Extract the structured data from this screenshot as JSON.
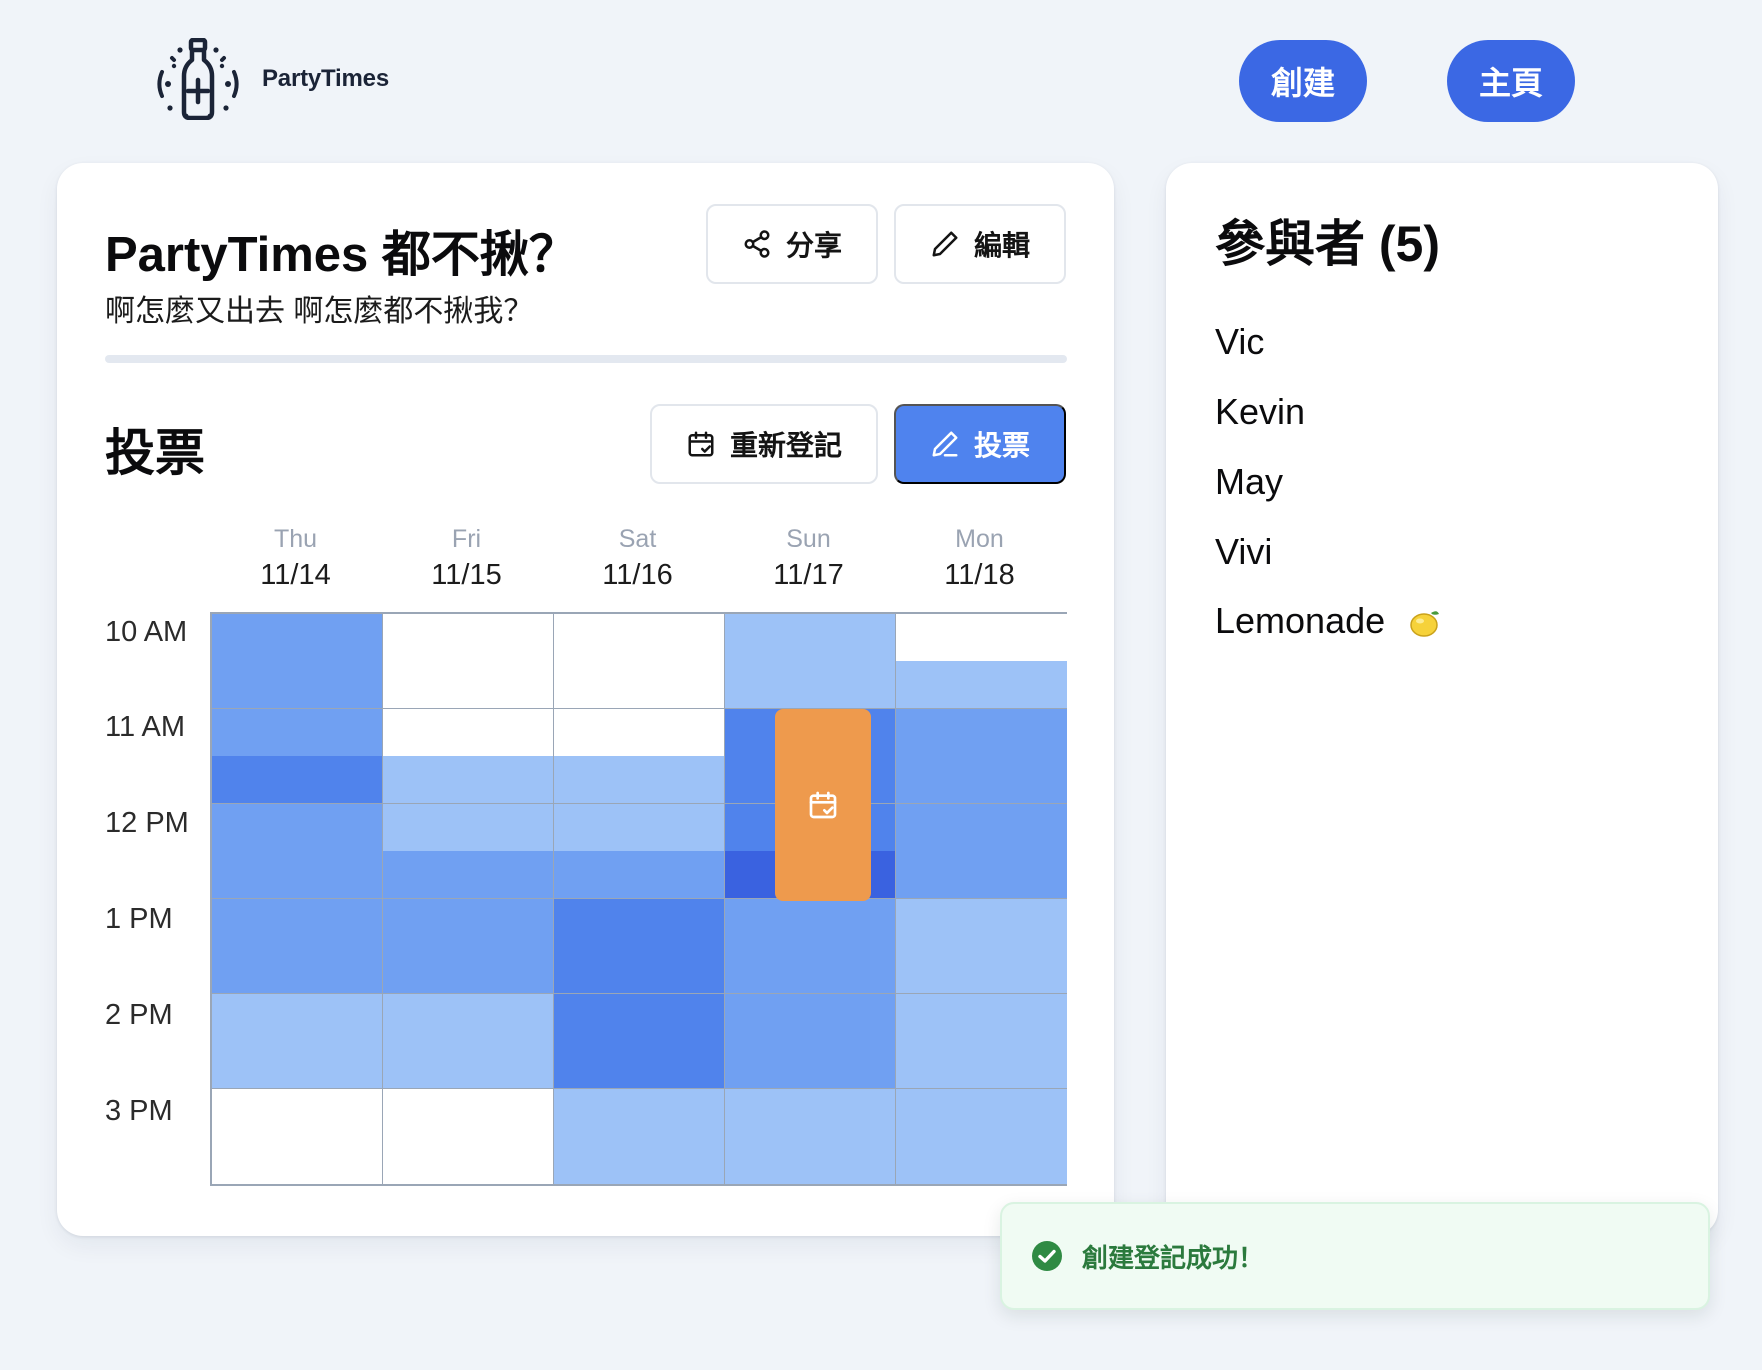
{
  "app": {
    "name": "PartyTimes"
  },
  "nav": {
    "create_label": "創建",
    "home_label": "主頁"
  },
  "event": {
    "title": "PartyTimes 都不揪？",
    "description": "啊怎麼又出去 啊怎麼都不揪我？",
    "share_label": "分享",
    "edit_label": "編輯"
  },
  "vote": {
    "title": "投票",
    "reregister_label": "重新登記",
    "vote_label": "投票"
  },
  "schedule": {
    "days": [
      {
        "name": "Thu",
        "date": "11/14"
      },
      {
        "name": "Fri",
        "date": "11/15"
      },
      {
        "name": "Sat",
        "date": "11/16"
      },
      {
        "name": "Sun",
        "date": "11/17"
      },
      {
        "name": "Mon",
        "date": "11/18"
      }
    ],
    "times": [
      "10 AM",
      "11 AM",
      "12 PM",
      "1 PM",
      "2 PM",
      "3 PM"
    ],
    "availability_levels": [
      [
        [
          3,
          3
        ],
        [
          3,
          4
        ],
        [
          3,
          3
        ],
        [
          3,
          3
        ],
        [
          2,
          2
        ],
        [
          0,
          0
        ]
      ],
      [
        [
          0,
          0
        ],
        [
          0,
          2
        ],
        [
          2,
          3
        ],
        [
          3,
          3
        ],
        [
          2,
          2
        ],
        [
          0,
          0
        ]
      ],
      [
        [
          0,
          0
        ],
        [
          0,
          2
        ],
        [
          2,
          3
        ],
        [
          4,
          4
        ],
        [
          4,
          4
        ],
        [
          2,
          2
        ]
      ],
      [
        [
          2,
          2
        ],
        [
          4,
          4
        ],
        [
          4,
          5
        ],
        [
          3,
          3
        ],
        [
          3,
          3
        ],
        [
          2,
          2
        ]
      ],
      [
        [
          0,
          2
        ],
        [
          3,
          3
        ],
        [
          3,
          3
        ],
        [
          2,
          2
        ],
        [
          2,
          2
        ],
        [
          2,
          2
        ]
      ]
    ],
    "level_colors": {
      "0": "#ffffff",
      "2": "#9dc2f7",
      "3": "#70a0f2",
      "4": "#5083ec",
      "5": "#3a62e0"
    },
    "selection_color": "#ee9a4d"
  },
  "participants": {
    "title": "參與者 (5)",
    "names": [
      "Vic",
      "Kevin",
      "May",
      "Vivi",
      "Lemonade"
    ]
  },
  "toast": {
    "message": "創建登記成功！"
  }
}
